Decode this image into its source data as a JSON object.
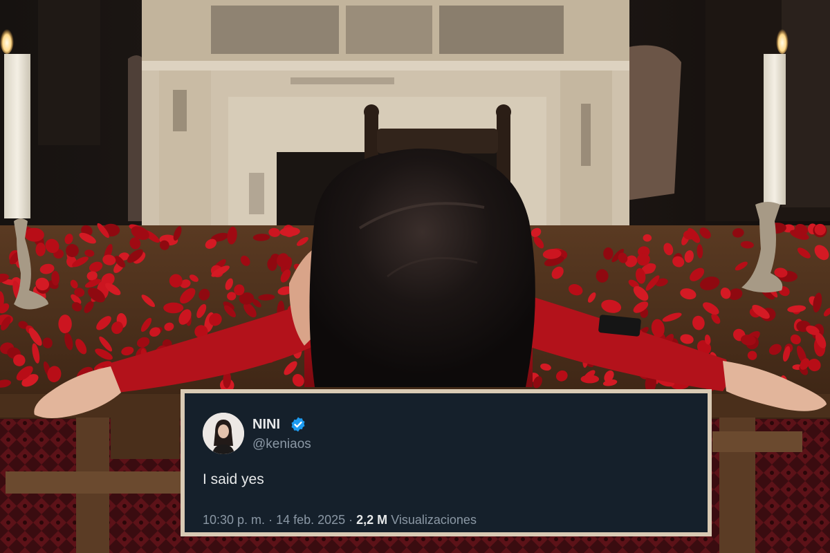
{
  "tweet": {
    "author_name": "NINI",
    "author_handle": "@keniaos",
    "verified": true,
    "text": "I said yes",
    "time": "10:30 p. m.",
    "separator": " · ",
    "date": "14 feb. 2025",
    "views_count": "2,2 M",
    "views_label": "Visualizaciones"
  },
  "colors": {
    "card_background": "#15202b",
    "card_border": "#d9cab4",
    "verified_badge": "#1d9bf0",
    "petals": "#b80d17",
    "dress": "#a70f18"
  },
  "icons": [
    "verified-badge-icon"
  ]
}
